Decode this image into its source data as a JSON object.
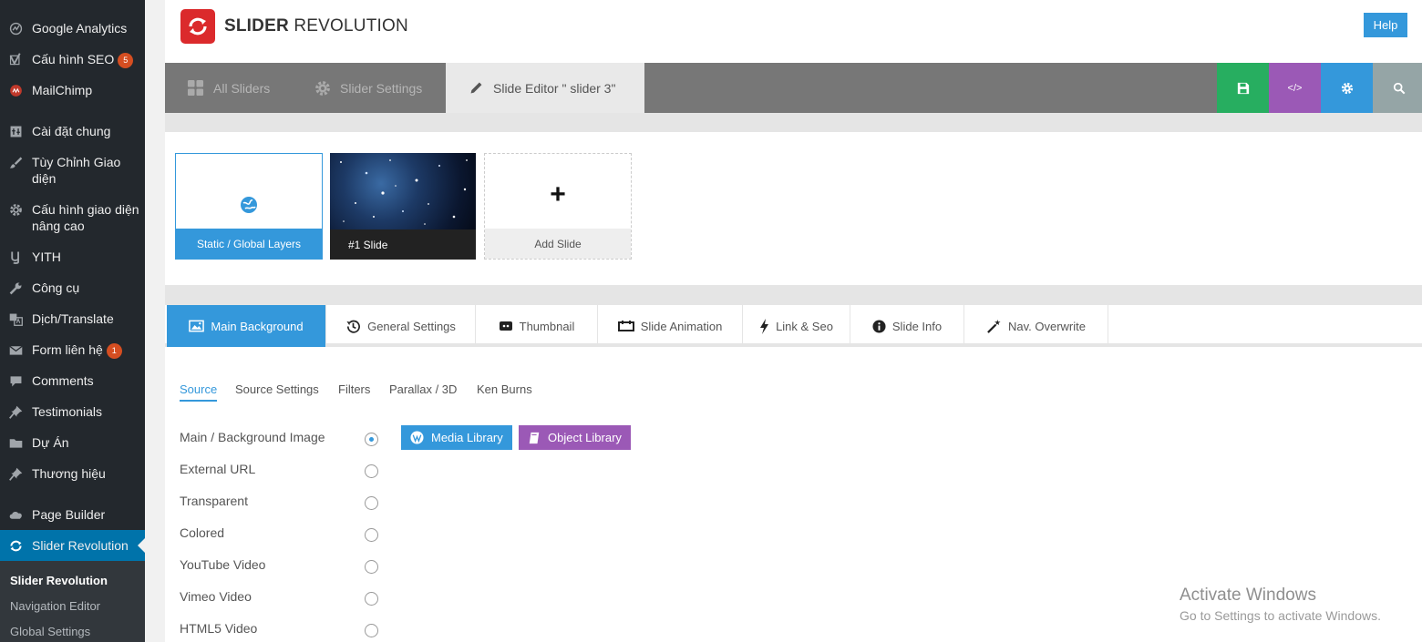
{
  "sidebar": {
    "items": [
      {
        "label": "Google Analytics",
        "icon": "analytics-icon"
      },
      {
        "label": "Cấu hình SEO",
        "icon": "yoast-icon",
        "badge": "5"
      },
      {
        "label": "MailChimp",
        "icon": "mailchimp-icon"
      },
      {
        "label": "Cài đặt chung",
        "icon": "settings-icon"
      },
      {
        "label": "Tùy Chỉnh Giao diện",
        "icon": "brush-icon"
      },
      {
        "label": "Cấu hình giao diện nâng cao",
        "icon": "gear-icon"
      },
      {
        "label": "YITH",
        "icon": "yith-icon"
      },
      {
        "label": "Công cụ",
        "icon": "wrench-icon"
      },
      {
        "label": "Dịch/Translate",
        "icon": "translate-icon"
      },
      {
        "label": "Form liên hệ",
        "icon": "mail-icon",
        "badge": "1"
      },
      {
        "label": "Comments",
        "icon": "comment-icon"
      },
      {
        "label": "Testimonials",
        "icon": "pin-icon"
      },
      {
        "label": "Dự Án",
        "icon": "folder-icon"
      },
      {
        "label": "Thương hiệu",
        "icon": "pin-icon"
      },
      {
        "label": "Page Builder",
        "icon": "cloud-icon"
      },
      {
        "label": "Slider Revolution",
        "icon": "refresh-icon"
      }
    ],
    "submenu": [
      "Slider Revolution",
      "Navigation Editor",
      "Global Settings"
    ]
  },
  "header": {
    "brand_bold": "SLIDER",
    "brand_rest": "REVOLUTION",
    "help": "Help"
  },
  "topbar": {
    "tabs": [
      "All Sliders",
      "Slider Settings",
      "Slide Editor \" slider 3\""
    ],
    "actions": {
      "save": "save-icon",
      "code": "</>",
      "settings": "gear-icon",
      "search": "search-icon"
    },
    "colors": {
      "save": "#27ae60",
      "code": "#9b59b6",
      "settings": "#3498db",
      "search": "#95a5a6"
    }
  },
  "slides": {
    "static": "Static / Global Layers",
    "slide1": "#1 Slide",
    "add": "Add Slide",
    "add_symbol": "+"
  },
  "settings_tabs": [
    "Main Background",
    "General Settings",
    "Thumbnail",
    "Slide Animation",
    "Link & Seo",
    "Slide Info",
    "Nav. Overwrite"
  ],
  "subtabs": [
    "Source",
    "Source Settings",
    "Filters",
    "Parallax / 3D",
    "Ken Burns"
  ],
  "sources": [
    {
      "label": "Main / Background Image",
      "checked": true
    },
    {
      "label": "External URL",
      "checked": false
    },
    {
      "label": "Transparent",
      "checked": false
    },
    {
      "label": "Colored",
      "checked": false
    },
    {
      "label": "YouTube Video",
      "checked": false
    },
    {
      "label": "Vimeo Video",
      "checked": false
    },
    {
      "label": "HTML5 Video",
      "checked": false
    }
  ],
  "buttons": {
    "media_library": "Media Library",
    "object_library": "Object Library"
  },
  "watermark": {
    "line1": "Activate Windows",
    "line2": "Go to Settings to activate Windows."
  }
}
